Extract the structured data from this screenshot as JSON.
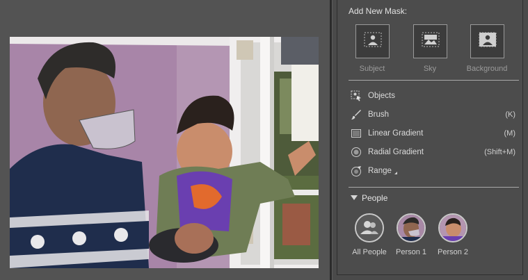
{
  "panel": {
    "header": "Add New Mask:",
    "mask_buttons": [
      {
        "label": "Subject",
        "icon": "subject-mask-icon"
      },
      {
        "label": "Sky",
        "icon": "sky-mask-icon"
      },
      {
        "label": "Background",
        "icon": "background-mask-icon"
      }
    ],
    "tools": [
      {
        "label": "Objects",
        "shortcut": "",
        "icon": "objects-icon"
      },
      {
        "label": "Brush",
        "shortcut": "(K)",
        "icon": "brush-icon"
      },
      {
        "label": "Linear Gradient",
        "shortcut": "(M)",
        "icon": "linear-gradient-icon"
      },
      {
        "label": "Radial Gradient",
        "shortcut": "(Shift+M)",
        "icon": "radial-gradient-icon"
      },
      {
        "label": "Range",
        "shortcut": "",
        "icon": "range-icon"
      }
    ],
    "people": {
      "header": "People",
      "items": [
        {
          "label": "All People"
        },
        {
          "label": "Person 1"
        },
        {
          "label": "Person 2"
        }
      ]
    }
  },
  "colors": {
    "workspace_bg": "#535353",
    "panel_bg": "#4c4c4c",
    "text_primary": "#dcdcdc",
    "text_dim": "#9b9b9b"
  }
}
